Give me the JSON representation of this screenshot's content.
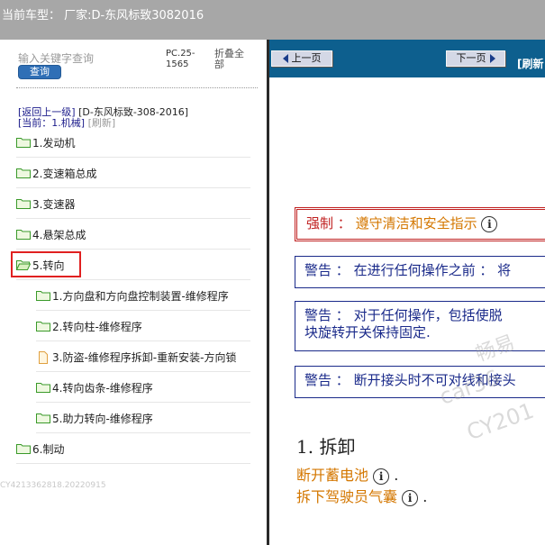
{
  "window": {
    "title": "当前车型：  厂家:D-东风标致3082016"
  },
  "left_panel": {
    "search": {
      "placeholder": "输入关键字查询",
      "button": "查询"
    },
    "pc_label": "PC.25-1565",
    "expand_all": "折叠全部",
    "nav": {
      "back_link": "[返回上一级]",
      "model": "[D-东风标致-308-2016]"
    },
    "current": {
      "prefix": "[当前：",
      "name": "1.机械",
      "suffix": "]",
      "refresh": "[刷新]"
    },
    "tree": [
      {
        "label": "1.发动机",
        "level": 1,
        "icon": "folder-icon"
      },
      {
        "label": "2.变速箱总成",
        "level": 1,
        "icon": "folder-icon"
      },
      {
        "label": "3.变速器",
        "level": 1,
        "icon": "folder-icon"
      },
      {
        "label": "4.悬架总成",
        "level": 1,
        "icon": "folder-icon"
      },
      {
        "label": "5.转向",
        "level": 1,
        "icon": "folder-open-icon",
        "selected": true
      },
      {
        "label": "1.方向盘和方向盘控制装置-维修程序",
        "level": 2,
        "icon": "folder-icon"
      },
      {
        "label": "2.转向柱-维修程序",
        "level": 2,
        "icon": "folder-icon"
      },
      {
        "label": "3.防盗-维修程序拆卸-重新安装-方向锁",
        "level": 2,
        "icon": "document-icon"
      },
      {
        "label": "4.转向齿条-维修程序",
        "level": 2,
        "icon": "folder-icon"
      },
      {
        "label": "5.助力转向-维修程序",
        "level": 2,
        "icon": "folder-icon"
      },
      {
        "label": "6.制动",
        "level": 1,
        "icon": "folder-icon"
      }
    ],
    "footer_code": "CY4213362818.20220915"
  },
  "right_panel": {
    "toolbar": {
      "prev": "上一页",
      "next": "下一页",
      "refresh": "[刷新"
    },
    "notices": [
      {
        "type": "danger",
        "label": "强制",
        "sep": "：",
        "text": "遵守清洁和安全指示"
      },
      {
        "type": "warning",
        "label": "警告",
        "sep": "：",
        "text": "在进行任何操作之前 ： 将"
      },
      {
        "type": "warning",
        "label": "警告",
        "sep": "：",
        "text": "对于任何操作，包括使脱",
        "text2": "块旋转开关保持固定."
      },
      {
        "type": "warning",
        "label": "警告",
        "sep": "：",
        "text": "断开接头时不可对线和接头"
      }
    ],
    "section_title": "1.  拆卸",
    "steps": [
      {
        "text": "断开蓄电池",
        "end": "."
      },
      {
        "text": "拆下驾驶员气囊",
        "end": "."
      }
    ],
    "watermarks": [
      "畅易",
      "car36",
      "CY201"
    ],
    "colors": {
      "toolbar": "#0d5f8e",
      "danger": "#c02020",
      "warning": "#1a2a8a",
      "step": "#d47700"
    }
  }
}
